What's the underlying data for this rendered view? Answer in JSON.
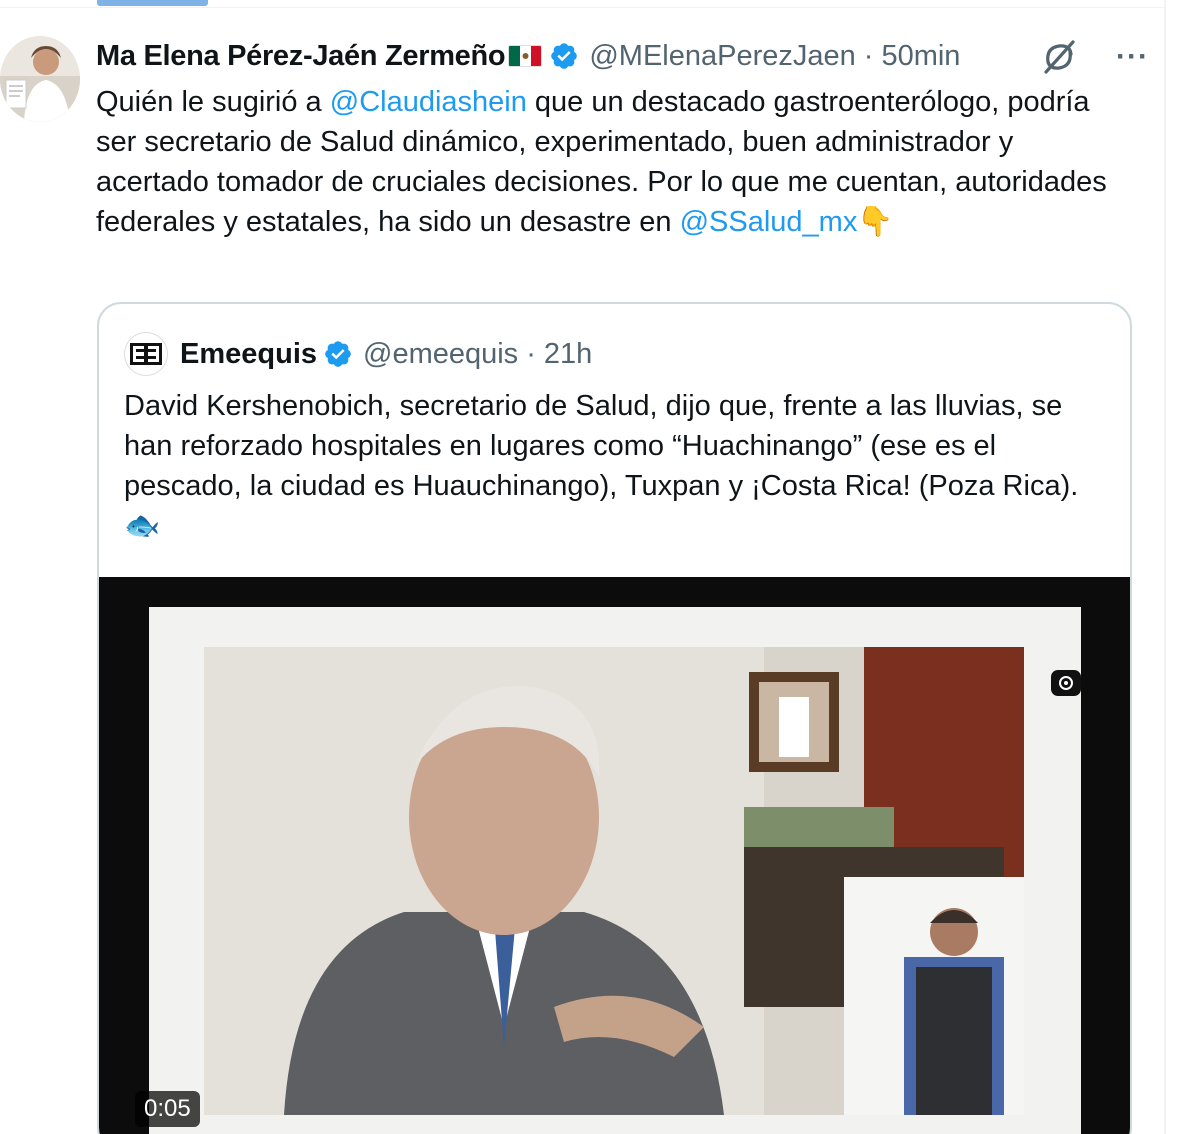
{
  "tweet": {
    "author": {
      "display_name": "Ma Elena Pérez-Jaén Zermeño",
      "handle": "@MElenaPerezJaen",
      "time": "50min",
      "separator": "·"
    },
    "text": {
      "part1": "Quién le sugirió a ",
      "mention1": "@Claudiashein",
      "part2": " que un destacado gastroenterólogo, podría ser secretario de Salud dinámico, experimentado, buen administrador y acertado tomador de cruciales decisiones. Por lo que me cuentan, autoridades federales y estatales, ha sido un desastre en ",
      "mention2": "@SSalud_mx",
      "emoji": "👇"
    },
    "icons": {
      "verified": "verified-badge-icon",
      "flag": "mexico-flag-icon",
      "grok": "grok-icon",
      "more": "more-options-icon"
    }
  },
  "quote": {
    "author": {
      "display_name": "Emeequis",
      "handle": "@emeequis",
      "time": "21h",
      "separator": "·"
    },
    "text": "David Kershenobich, secretario de Salud, dijo que, frente a las lluvias, se han reforzado hospitales en lugares como “Huachinango” (ese es el pescado, la ciudad es Huauchinango), Tuxpan y ¡Costa Rica! (Poza Rica).",
    "emoji": "🐟",
    "video": {
      "duration": "0:05"
    }
  },
  "colors": {
    "link": "#1d9bf0",
    "verified": "#1d9bf0",
    "text_primary": "#0f1419",
    "text_secondary": "#536471",
    "border": "#cfd9de"
  }
}
